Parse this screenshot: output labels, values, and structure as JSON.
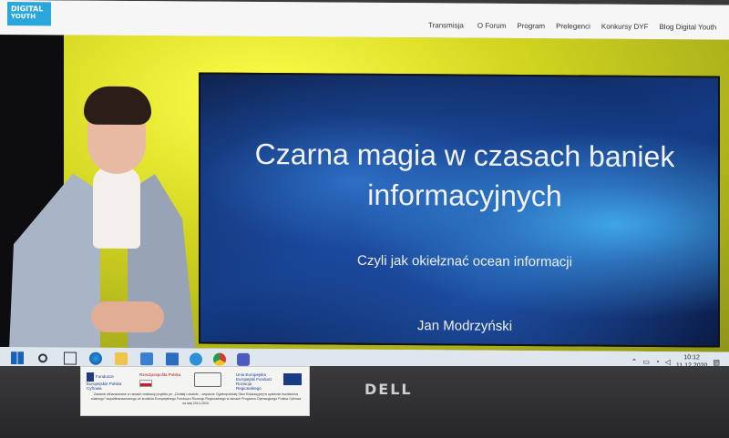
{
  "website": {
    "logo_line1": "DIGITAL",
    "logo_line2": "YOUTH",
    "nav": [
      "Transmisja",
      "O Forum",
      "Program",
      "Prelegenci",
      "Konkursy DYF",
      "Blog Digital Youth"
    ]
  },
  "slide": {
    "title": "Czarna magia w czasach baniek informacyjnych",
    "subtitle": "Czyli jak okiełznać ocean informacji",
    "author": "Jan Modrzyński"
  },
  "taskbar": {
    "icons": [
      "start-icon",
      "search-icon",
      "task-view-icon",
      "edge-icon",
      "file-explorer-icon",
      "store-icon",
      "mail-icon",
      "app-icon",
      "chrome-icon",
      "teams-icon"
    ],
    "time": "10:12",
    "date": "11.12.2020"
  },
  "laptop": {
    "brand": "DELL"
  },
  "sticker": {
    "eu_fund_label": "Fundusze Europejskie Polska Cyfrowa",
    "poland_label": "Rzeczpospolita Polska",
    "eu_label": "Unia Europejska Europejski Fundusz Rozwoju Regionalnego",
    "text": "Zadanie sfinansowane w ramach realizacji projektu pn. „Działaj Lokalnie – wsparcie Ogólnopolskiej Sieci Edukacyjnej w systemie kształcenia zdalnego” współfinansowanego ze środków Europejskiego Funduszu Rozwoju Regionalnego w ramach Programu Operacyjnego Polska Cyfrowa na lata 2014-2020."
  },
  "colors": {
    "logo_bg": "#29a6dc",
    "slide_bg": "#143b85",
    "stage_bg": "#d2d51f"
  }
}
